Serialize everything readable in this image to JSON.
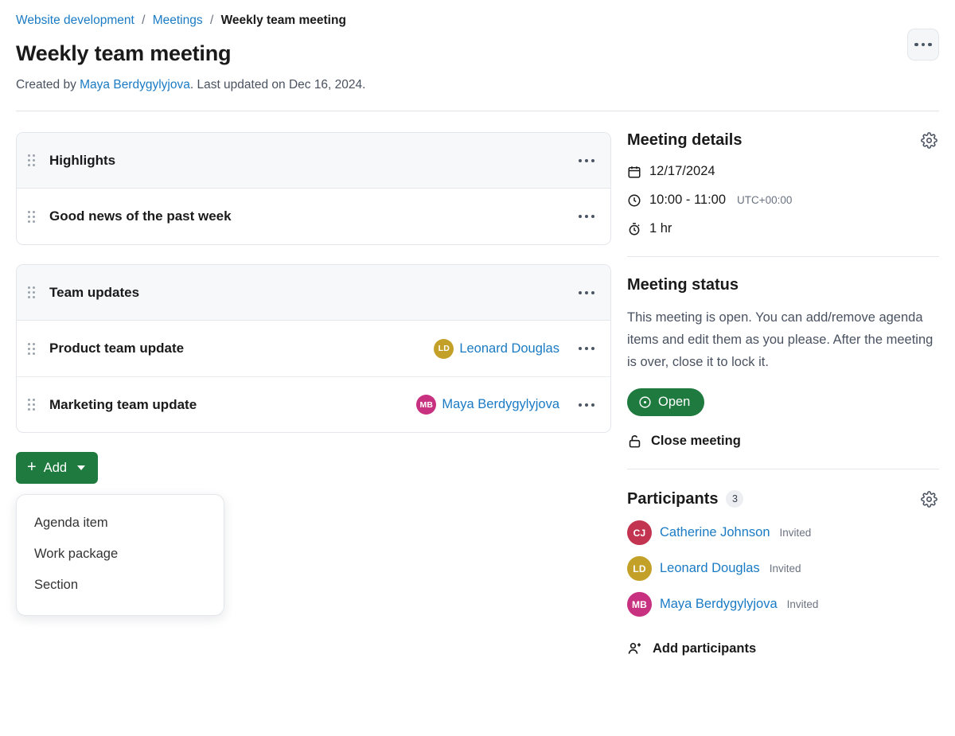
{
  "breadcrumb": {
    "items": [
      {
        "label": "Website development",
        "current": false
      },
      {
        "label": "Meetings",
        "current": false
      },
      {
        "label": "Weekly team meeting",
        "current": true
      }
    ],
    "separator": "/"
  },
  "header": {
    "title": "Weekly team meeting",
    "created_prefix": "Created by ",
    "created_by": "Maya Berdygylyjova",
    "updated_text": ". Last updated on Dec 16, 2024.",
    "more_icon": "ellipsis-icon"
  },
  "agenda": {
    "sections": [
      {
        "title": "Highlights",
        "drag_icon": "drag-handle-icon",
        "more_icon": "ellipsis-icon",
        "items": [
          {
            "title": "Good news of the past week",
            "presenter": null,
            "initials": null,
            "color": null
          }
        ]
      },
      {
        "title": "Team updates",
        "drag_icon": "drag-handle-icon",
        "more_icon": "ellipsis-icon",
        "items": [
          {
            "title": "Product team update",
            "presenter": "Leonard Douglas",
            "initials": "LD",
            "color": "#c3a129"
          },
          {
            "title": "Marketing team update",
            "presenter": "Maya Berdygylyjova",
            "initials": "MB",
            "color": "#c7317f"
          }
        ]
      }
    ],
    "add_button": {
      "label": "Add",
      "plus_icon": "plus-icon",
      "caret_icon": "chevron-down-icon",
      "color": "#1f7a3f"
    },
    "add_menu": {
      "open": true,
      "items": [
        "Agenda item",
        "Work package",
        "Section"
      ]
    }
  },
  "sidebar": {
    "meeting_details": {
      "title": "Meeting details",
      "gear_icon": "gear-icon",
      "date": "12/17/2024",
      "date_icon": "calendar-icon",
      "time": "10:00 - 11:00",
      "timezone": "UTC+00:00",
      "time_icon": "clock-icon",
      "duration": "1 hr",
      "duration_icon": "stopwatch-icon"
    },
    "meeting_status": {
      "title": "Meeting status",
      "description": "This meeting is open. You can add/remove agenda items and edit them as you please. After the meeting is over, close it to lock it.",
      "status_label": "Open",
      "status_icon": "dot-circle-icon",
      "status_color": "#1f7a3f",
      "close_label": "Close meeting",
      "close_icon": "unlock-icon"
    },
    "participants": {
      "title": "Participants",
      "count": "3",
      "gear_icon": "gear-icon",
      "people": [
        {
          "name": "Catherine Johnson",
          "initials": "CJ",
          "state": "Invited",
          "color": "#c2344f"
        },
        {
          "name": "Leonard Douglas",
          "initials": "LD",
          "state": "Invited",
          "color": "#c3a129"
        },
        {
          "name": "Maya Berdygylyjova",
          "initials": "MB",
          "state": "Invited",
          "color": "#c7317f"
        }
      ],
      "add_label": "Add participants",
      "add_icon": "person-plus-icon"
    }
  }
}
